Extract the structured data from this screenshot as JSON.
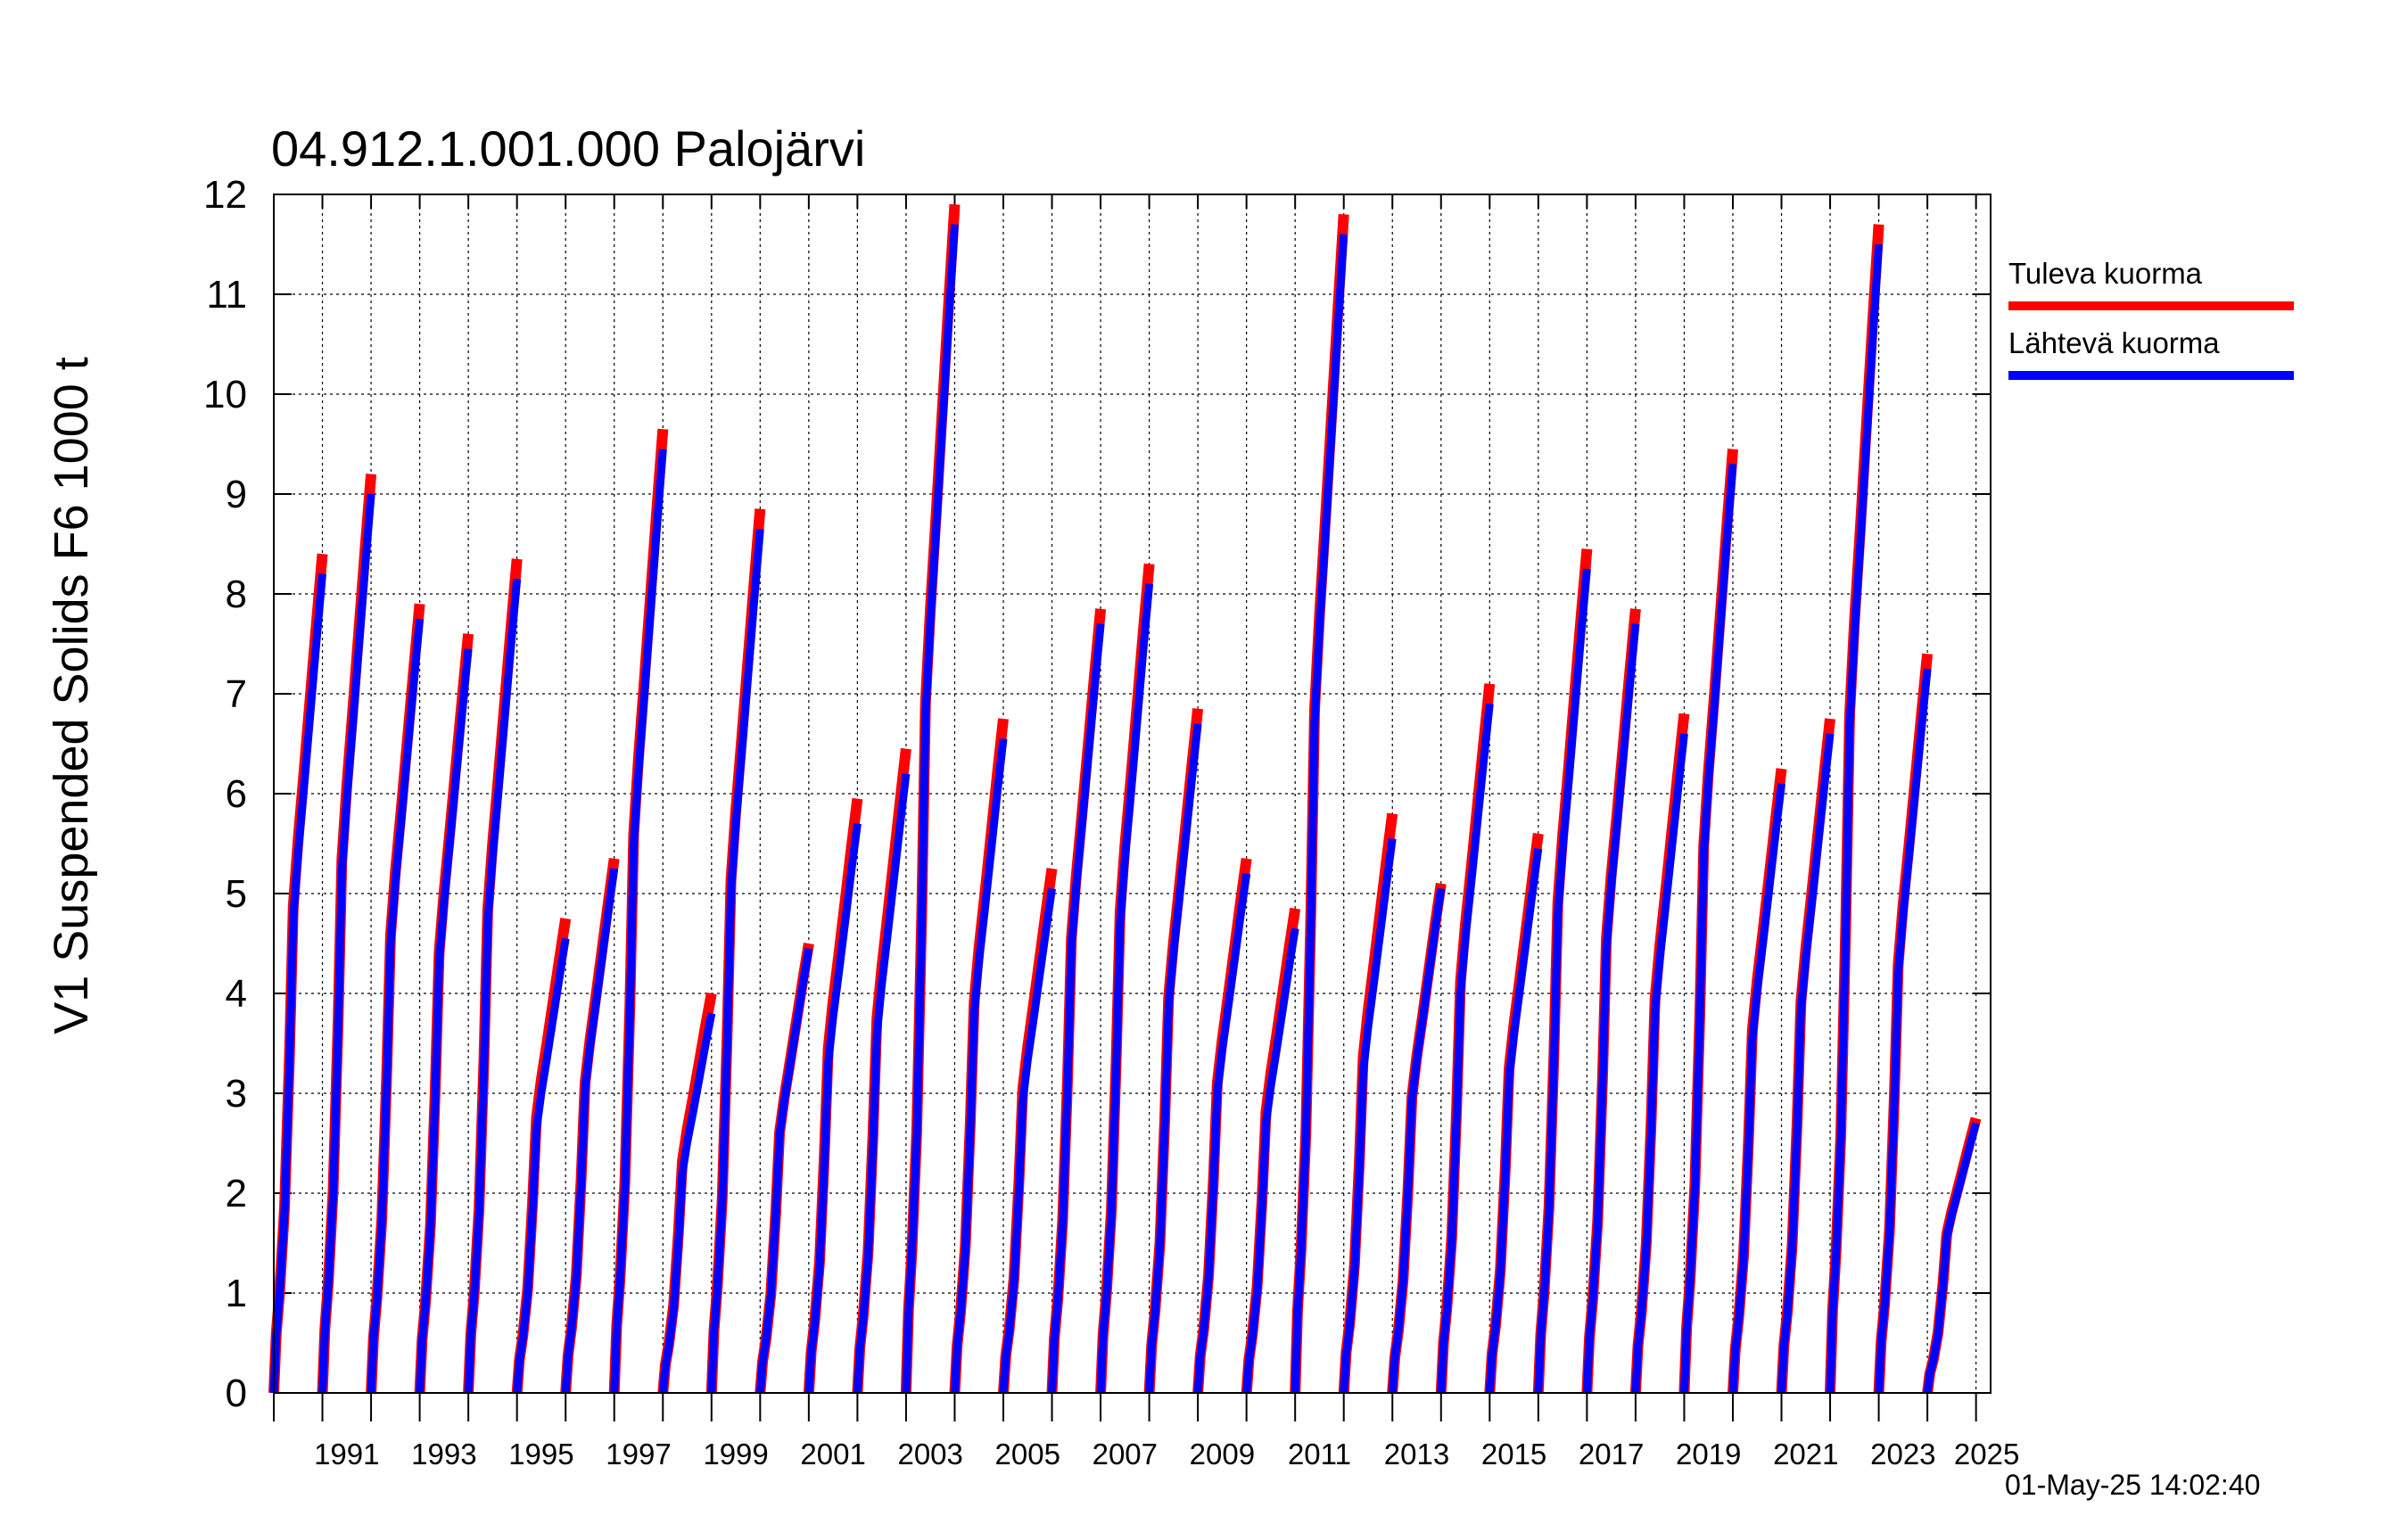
{
  "chart_data": {
    "type": "line",
    "title": "04.912.1.001.000 Palojärvi",
    "ylabel": "V1 Suspended Solids F6 1000 t",
    "xlabel": "",
    "ylim": [
      0,
      12
    ],
    "yticks": [
      0,
      1,
      2,
      3,
      4,
      5,
      6,
      7,
      8,
      9,
      10,
      11,
      12
    ],
    "xlim": [
      1990,
      2025.3
    ],
    "xtick_labels": [
      "1991",
      "1993",
      "1995",
      "1997",
      "1999",
      "2001",
      "2003",
      "2005",
      "2007",
      "2009",
      "2011",
      "2013",
      "2015",
      "2017",
      "2019",
      "2021",
      "2023",
      "2025"
    ],
    "grid": true,
    "legend_position": "right",
    "timestamp": "01-May-25 14:02:40",
    "years": [
      1990,
      1991,
      1992,
      1993,
      1994,
      1995,
      1996,
      1997,
      1998,
      1999,
      2000,
      2001,
      2002,
      2003,
      2004,
      2005,
      2006,
      2007,
      2008,
      2009,
      2010,
      2011,
      2012,
      2013,
      2014,
      2015,
      2016,
      2017,
      2018,
      2019,
      2020,
      2021,
      2022,
      2023,
      2024,
      2025
    ],
    "series": [
      {
        "name": "Tuleva kuorma",
        "color": "#ff0000",
        "annual_totals": [
          8.4,
          9.2,
          7.9,
          7.6,
          8.35,
          4.75,
          5.35,
          9.65,
          4.0,
          8.85,
          4.5,
          5.95,
          6.45,
          11.9,
          6.75,
          5.25,
          7.85,
          8.3,
          6.85,
          5.35,
          4.85,
          11.8,
          5.8,
          5.1,
          7.1,
          5.6,
          8.45,
          7.85,
          6.8,
          9.45,
          6.25,
          6.75,
          11.7,
          7.4,
          2.75
        ]
      },
      {
        "name": "Lähtevä kuorma",
        "color": "#0000ff",
        "annual_totals": [
          8.2,
          9.0,
          7.75,
          7.45,
          8.15,
          4.55,
          5.25,
          9.45,
          3.8,
          8.65,
          4.45,
          5.7,
          6.2,
          11.7,
          6.55,
          5.05,
          7.7,
          8.1,
          6.7,
          5.2,
          4.65,
          11.6,
          5.55,
          5.05,
          6.9,
          5.45,
          8.25,
          7.7,
          6.6,
          9.3,
          6.1,
          6.6,
          11.5,
          7.25,
          2.7
        ]
      }
    ]
  }
}
